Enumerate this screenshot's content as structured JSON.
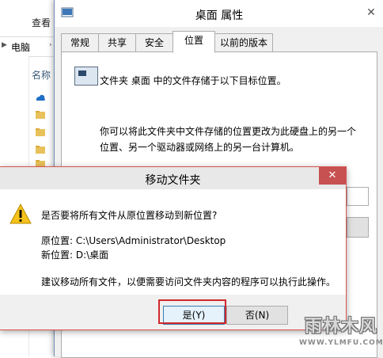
{
  "explorer": {
    "tabs": [
      "查看"
    ],
    "address_label": "电脑",
    "column_header": "名称"
  },
  "properties": {
    "title": "桌面 属性",
    "tabs": [
      "常规",
      "共享",
      "安全",
      "位置",
      "以前的版本"
    ],
    "active_tab": "位置",
    "description": "文件夹 桌面 中的文件存储于以下目标位置。",
    "paragraph": "你可以将此文件夹中文件存储的位置更改为此硬盘上的另一个位置、另一个驱动器或网络上的另一台计算机。"
  },
  "move_dialog": {
    "title": "移动文件夹",
    "question": "是否要将所有文件从原位置移动到新位置?",
    "original_location": "原位置: C:\\Users\\Administrator\\Desktop",
    "new_location": "新位置: D:\\桌面",
    "note": "建议移动所有文件，以便需要访问文件夹内容的程序可以执行此操作。",
    "yes_label": "是(Y)",
    "no_label": "否(N)"
  },
  "watermark": {
    "brand": "雨林木风",
    "url": "WWW.YLMFU.COM"
  },
  "colors": {
    "highlight_box": "#d0282c",
    "close_button": "#c75050",
    "dialog_bg": "#f0f0f0"
  }
}
